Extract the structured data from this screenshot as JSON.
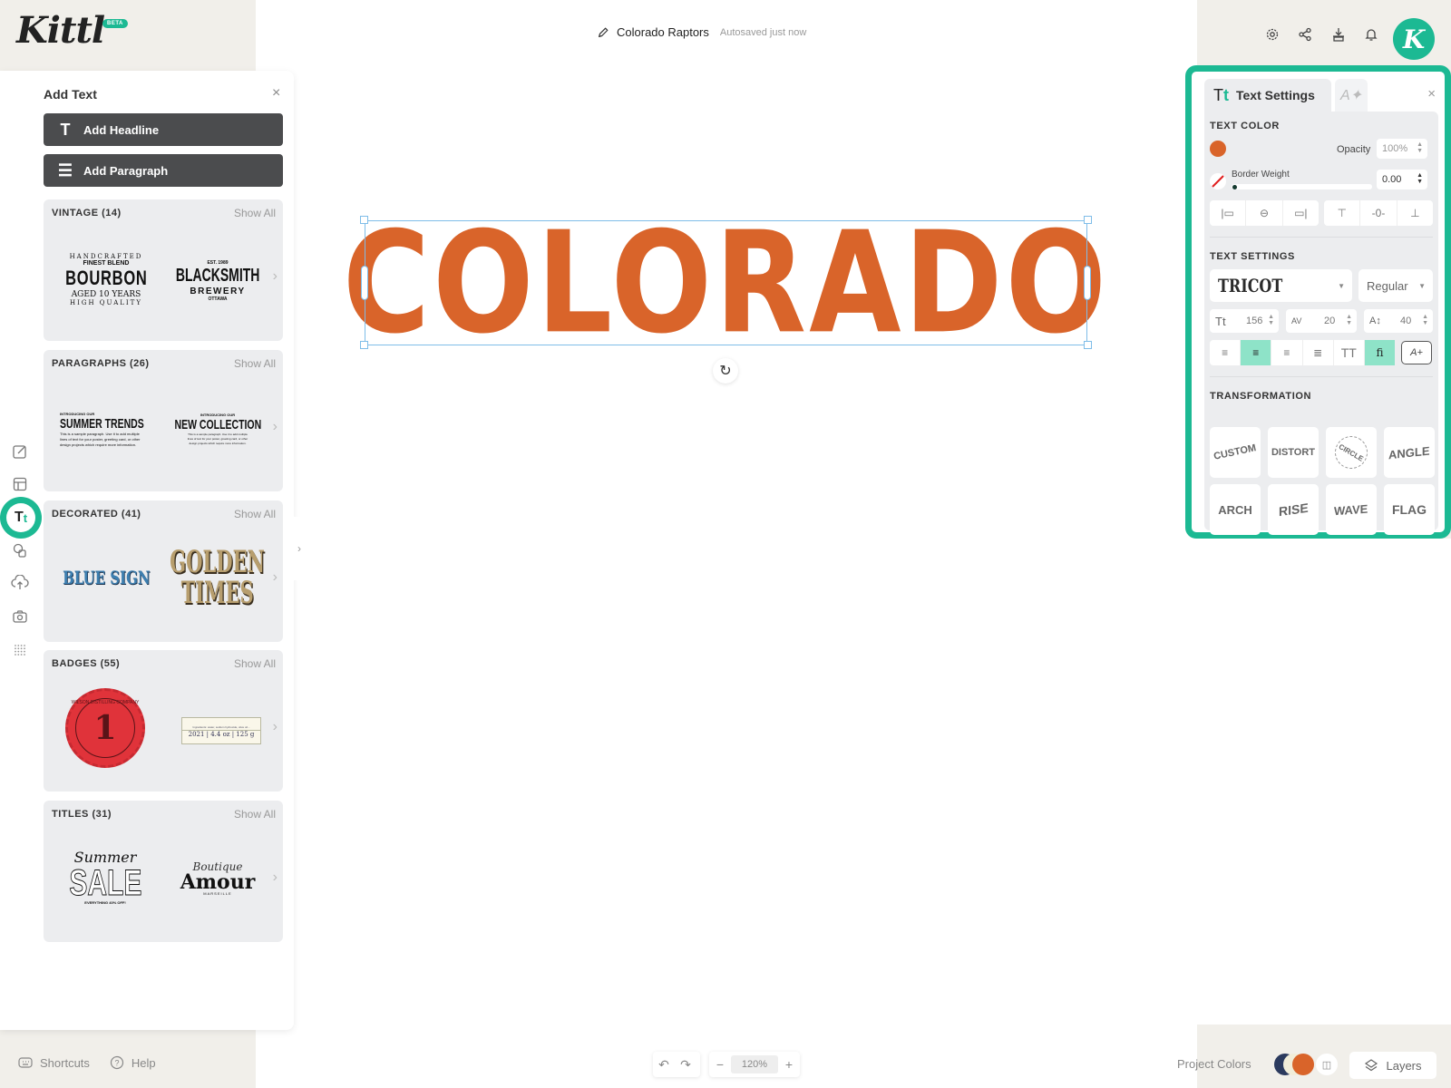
{
  "app": {
    "logo": "Kittl",
    "badge": "BETA",
    "avatar_letter": "K",
    "accent_color": "#1cb993"
  },
  "header": {
    "doc_name": "Colorado Raptors",
    "status": "Autosaved just now",
    "icons": [
      "settings-icon",
      "share-icon",
      "download-icon",
      "bell-icon"
    ]
  },
  "tool_rail": {
    "items": [
      "edit-icon",
      "layout-icon",
      "text-icon",
      "shapes-icon",
      "upload-icon",
      "camera-icon",
      "grid-icon"
    ],
    "active": "text-icon",
    "active_label": "Tt"
  },
  "add_text_panel": {
    "title": "Add Text",
    "buttons": [
      {
        "label": "Add Headline",
        "icon": "T"
      },
      {
        "label": "Add Paragraph",
        "icon": "☰"
      }
    ],
    "show_all_label": "Show All",
    "categories": [
      {
        "title": "VINTAGE (14)",
        "thumbs": [
          {
            "lines": [
              "HANDCRAFTED",
              "FINEST BLEND",
              "BOURBON",
              "AGED 10 YEARS",
              "HIGH QUALITY"
            ]
          },
          {
            "lines": [
              "EST. 1989",
              "BLACKSMITH",
              "BREWERY",
              "OTTAWA"
            ]
          }
        ]
      },
      {
        "title": "PARAGRAPHS (26)",
        "thumbs": [
          {
            "lines": [
              "INTRODUCING OUR",
              "SUMMER TRENDS",
              "This is a sample paragraph. Use it to add multiple lines of text for your poster, greeting card, or other design projects which require more information."
            ]
          },
          {
            "lines": [
              "INTRODUCING OUR",
              "NEW COLLECTION",
              "This is a sample paragraph. Use it to add multiple lines of text for your poster, greeting card, or other design projects which require more information."
            ]
          }
        ]
      },
      {
        "title": "DECORATED (41)",
        "thumbs": [
          {
            "lines": [
              "BLUE SIGN"
            ]
          },
          {
            "lines": [
              "GOLDEN",
              "TIMES"
            ]
          }
        ]
      },
      {
        "title": "BADGES (55)",
        "thumbs": [
          {
            "lines": [
              "WILSON DISTILLING COMPANY",
              "1"
            ]
          },
          {
            "lines": [
              "Ingredients: water, sodium hydroxide, olive oil...",
              "2021 | 4.4 oz | 125 g"
            ]
          }
        ]
      },
      {
        "title": "TITLES (31)",
        "thumbs": [
          {
            "lines": [
              "Summer",
              "SALE",
              "EVERYTHING 40% OFF!"
            ]
          },
          {
            "lines": [
              "Boutique",
              "Amour",
              "MARSEILLE"
            ]
          }
        ]
      }
    ]
  },
  "canvas": {
    "text": "COLORADO",
    "text_color": "#d9642a"
  },
  "text_settings": {
    "tab_label": "Text Settings",
    "tab_icon": "Tt",
    "text_color_title": "TEXT COLOR",
    "color": "#d9642a",
    "opacity_label": "Opacity",
    "opacity": "100%",
    "border_weight_label": "Border Weight",
    "border_weight": "0.00",
    "border_weight_fraction": 0,
    "align_buttons": [
      "align-left-icon",
      "align-center-h-icon",
      "align-right-icon",
      "align-top-icon",
      "align-middle-v-icon",
      "align-bottom-icon"
    ],
    "text_settings_title": "TEXT SETTINGS",
    "font": "TRICOT",
    "weight": "Regular",
    "font_size": "156",
    "letter_spacing": "20",
    "line_height": "40",
    "font_size_icon": "Tt",
    "letter_spacing_icon": "AV",
    "line_height_icon": "A↕",
    "text_align": [
      "left",
      "center",
      "right",
      "justify"
    ],
    "active_align": "center",
    "uppercase_label": "TT",
    "ligature_label": "fi",
    "ligature_on": true,
    "extra_label": "A+",
    "transformation_title": "TRANSFORMATION",
    "transformations": [
      "CUSTOM",
      "DISTORT",
      "CIRCLE",
      "ANGLE",
      "ARCH",
      "RISE",
      "WAVE",
      "FLAG"
    ]
  },
  "bottom": {
    "shortcuts_label": "Shortcuts",
    "help_label": "Help",
    "zoom": "120%",
    "project_colors_label": "Project Colors",
    "project_colors": [
      "#2b3a5e",
      "#f1edd9",
      "#d9642a"
    ],
    "layers_label": "Layers"
  }
}
